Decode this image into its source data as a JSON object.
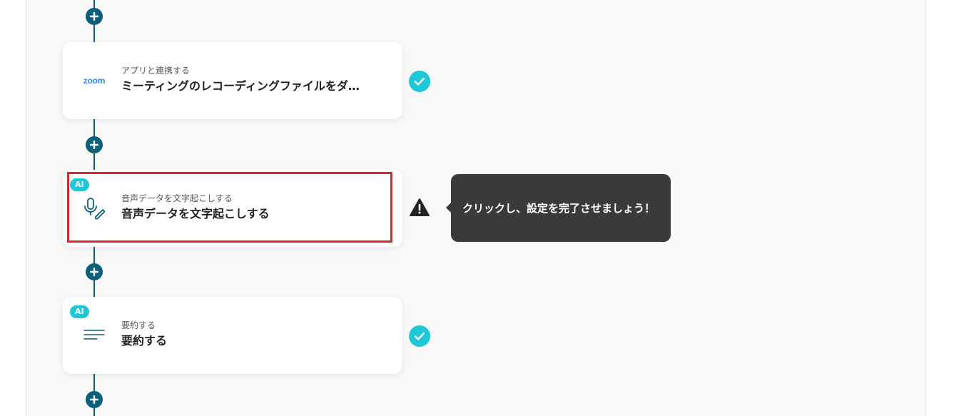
{
  "flow": {
    "steps": [
      {
        "id": "zoom",
        "ai": false,
        "icon": "zoom-logo",
        "logo_text": "zoom",
        "subtitle": "アプリと連携する",
        "title": "ミーティングのレコーディングファイルをダ…",
        "status": "complete"
      },
      {
        "id": "transcribe",
        "ai": true,
        "ai_label": "AI",
        "icon": "microphone-pen-icon",
        "subtitle": "音声データを文字起こしする",
        "title": "音声データを文字起こしする",
        "status": "warning"
      },
      {
        "id": "summarize",
        "ai": true,
        "ai_label": "AI",
        "icon": "text-lines-icon",
        "subtitle": "要約する",
        "title": "要約する",
        "status": "complete"
      }
    ]
  },
  "tooltip": {
    "text": "クリックし、設定を完了させましょう！"
  },
  "colors": {
    "connector": "#0b5f7a",
    "check": "#1ec8d8",
    "warning": "#222222",
    "highlight": "#d62828",
    "tooltip_bg": "#3a3a3a"
  }
}
